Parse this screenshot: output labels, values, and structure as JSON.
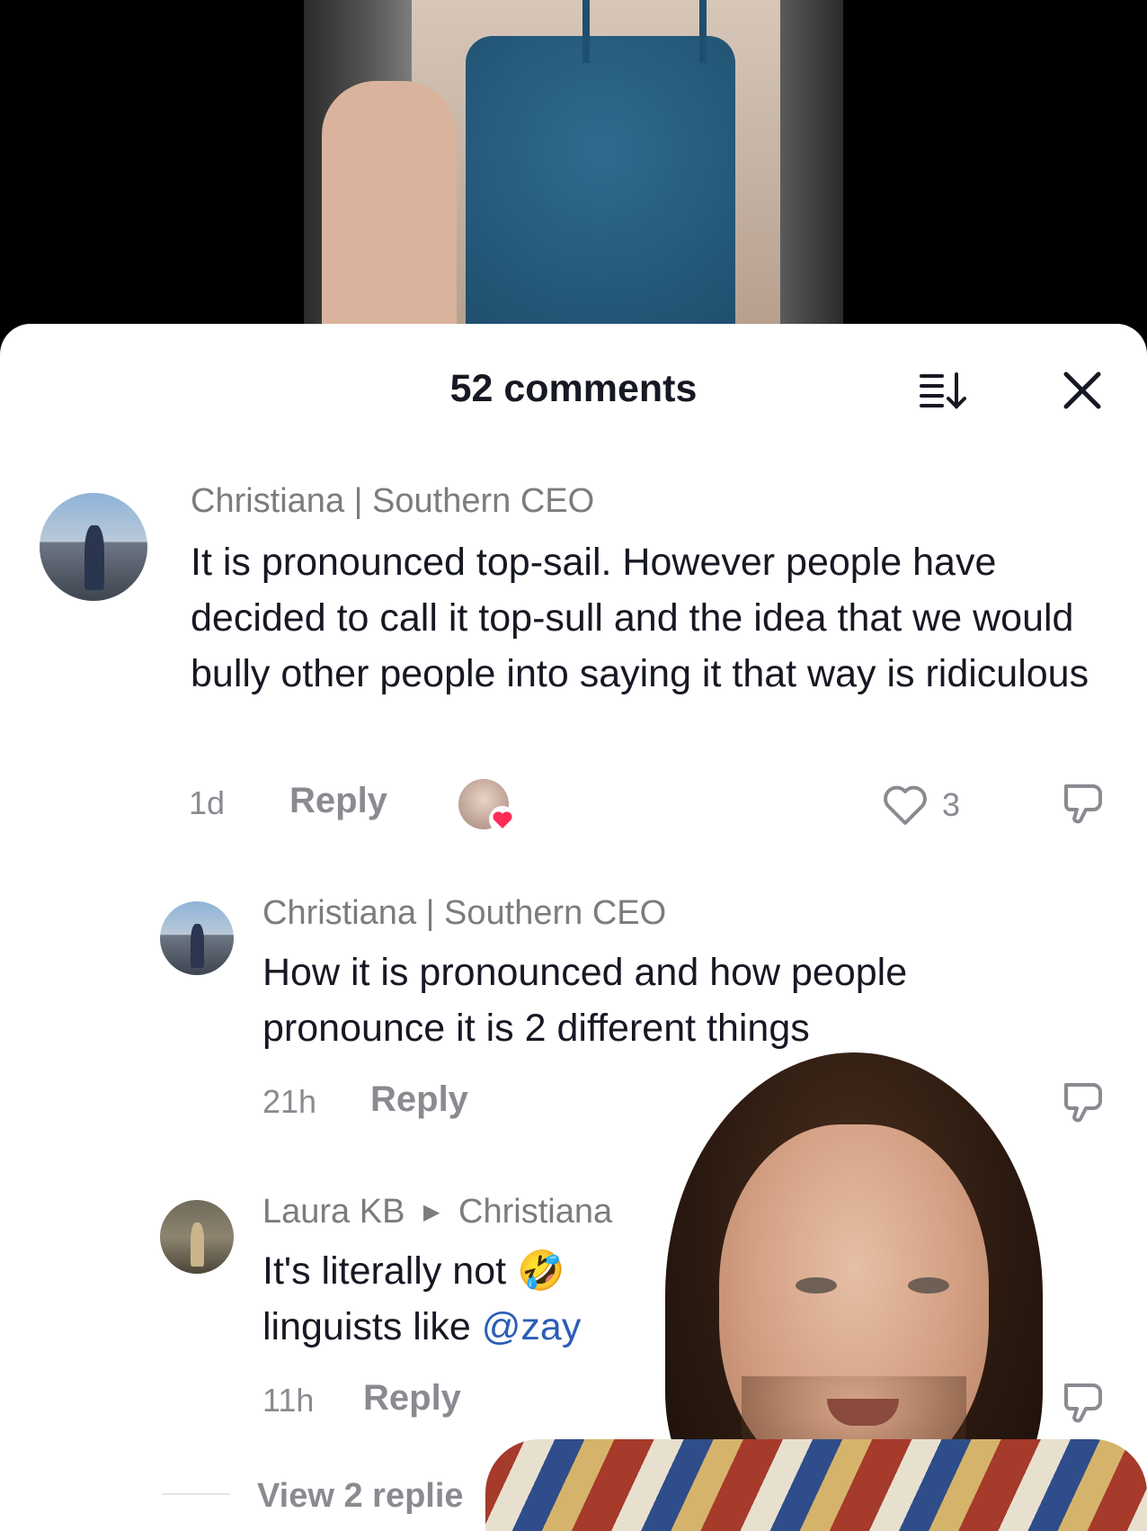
{
  "sheet": {
    "title": "52 comments"
  },
  "comments": [
    {
      "username": "Christiana | Southern CEO",
      "text": "It is pronounced top-sail. However people have decided to call it top-sull and the idea that we would bully other people into saying it that way is ridiculous",
      "time": "1d",
      "reply_label": "Reply",
      "likes": "3"
    },
    {
      "username": "Christiana | Southern CEO",
      "text": "How it is pronounced and how people pronounce it is 2 different things",
      "time": "21h",
      "reply_label": "Reply"
    },
    {
      "username": "Laura KB",
      "reply_to": "Christiana",
      "text_line1": "It's literally not",
      "text_line2_prefix": "linguists like ",
      "mention": "@zay",
      "time": "11h",
      "reply_label": "Reply"
    }
  ],
  "view_replies": "View 2 replie",
  "colors": {
    "heart_red": "#fe2c55",
    "mention_blue": "#2b5db8",
    "muted_gray": "#8a8b91"
  },
  "icons": {
    "sort": "sort-icon",
    "close": "close-icon",
    "like": "heart-outline-icon",
    "dislike": "thumbs-down-icon",
    "emoji": "rofl-emoji-icon"
  }
}
